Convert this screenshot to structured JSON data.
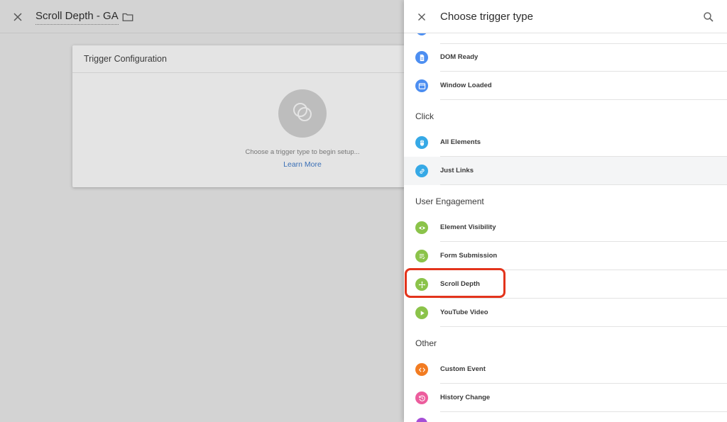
{
  "editor": {
    "title": "Scroll Depth - GA",
    "close_icon": "close-icon",
    "folder_icon": "folder-icon"
  },
  "config_card": {
    "header": "Trigger Configuration",
    "hint": "Choose a trigger type to begin setup...",
    "learn_more": "Learn More",
    "placeholder_icon": "overlapping-circles-icon"
  },
  "panel": {
    "title": "Choose trigger type",
    "close_icon": "close-icon",
    "search_icon": "search-icon"
  },
  "list": [
    {
      "kind": "item",
      "label": "DOM Ready",
      "icon": "document-icon",
      "color": "#4c8ef1"
    },
    {
      "kind": "item",
      "label": "Window Loaded",
      "icon": "window-icon",
      "color": "#4c8ef1"
    },
    {
      "kind": "section",
      "label": "Click"
    },
    {
      "kind": "item",
      "label": "All Elements",
      "icon": "mouse-icon",
      "color": "#36a9e6"
    },
    {
      "kind": "item",
      "label": "Just Links",
      "icon": "link-icon",
      "color": "#36a9e6",
      "hover": true
    },
    {
      "kind": "section",
      "label": "User Engagement"
    },
    {
      "kind": "item",
      "label": "Element Visibility",
      "icon": "eye-icon",
      "color": "#8bc34a"
    },
    {
      "kind": "item",
      "label": "Form Submission",
      "icon": "form-icon",
      "color": "#8bc34a"
    },
    {
      "kind": "item",
      "label": "Scroll Depth",
      "icon": "move-arrows-icon",
      "color": "#8bc34a",
      "highlighted": true
    },
    {
      "kind": "item",
      "label": "YouTube Video",
      "icon": "play-icon",
      "color": "#8bc34a"
    },
    {
      "kind": "section",
      "label": "Other"
    },
    {
      "kind": "item",
      "label": "Custom Event",
      "icon": "code-icon",
      "color": "#f27c22"
    },
    {
      "kind": "item",
      "label": "History Change",
      "icon": "history-icon",
      "color": "#ec5d9d"
    }
  ],
  "highlight_color": "#e3341c"
}
